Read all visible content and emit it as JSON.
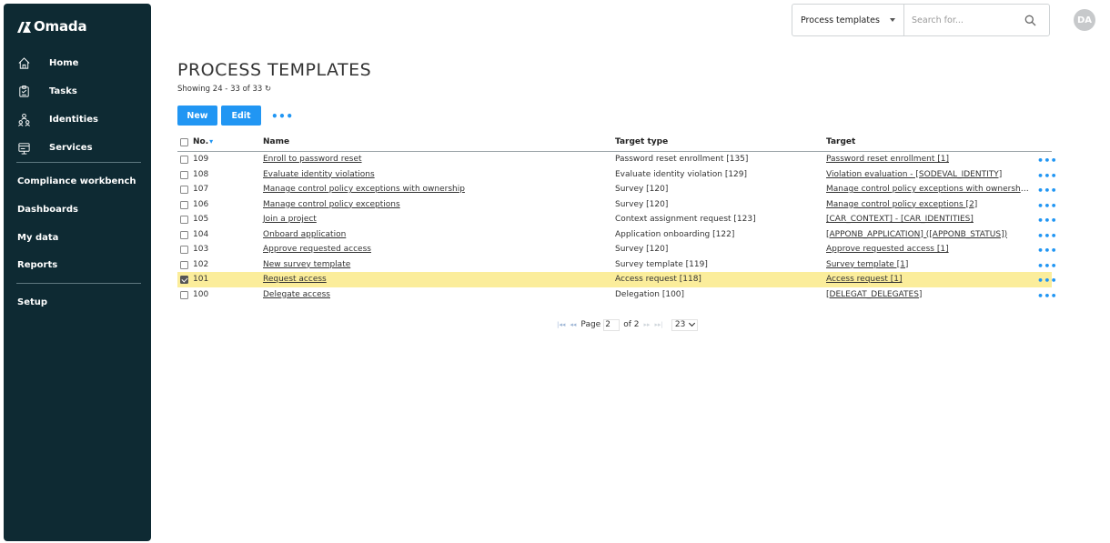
{
  "app": {
    "brand": "Omada"
  },
  "sidebar": {
    "main_items": [
      {
        "label": "Home",
        "icon": "home-icon"
      },
      {
        "label": "Tasks",
        "icon": "tasks-icon"
      },
      {
        "label": "Identities",
        "icon": "identities-icon"
      },
      {
        "label": "Services",
        "icon": "services-icon"
      }
    ],
    "secondary_items": [
      {
        "label": "Compliance workbench"
      },
      {
        "label": "Dashboards"
      },
      {
        "label": "My data"
      },
      {
        "label": "Reports"
      }
    ],
    "tertiary_items": [
      {
        "label": "Setup"
      }
    ]
  },
  "topbar": {
    "search_scope": "Process templates",
    "search_placeholder": "Search for...",
    "avatar_initials": "DA"
  },
  "page": {
    "title": "PROCESS TEMPLATES",
    "showing": "Showing 24 - 33 of 33",
    "refresh_glyph": "↻",
    "new_label": "New",
    "edit_label": "Edit",
    "more_glyph": "•••"
  },
  "table": {
    "headers": {
      "no": "No.",
      "name": "Name",
      "target_type": "Target type",
      "target": "Target"
    },
    "rows": [
      {
        "no": "109",
        "name": "Enroll to password reset",
        "target_type": "Password reset enrollment [135]",
        "target": "Password reset enrollment [1]",
        "checked": false
      },
      {
        "no": "108",
        "name": "Evaluate identity violations",
        "target_type": "Evaluate identity violation [129]",
        "target": "Violation evaluation - [SODEVAL_IDENTITY]",
        "checked": false
      },
      {
        "no": "107",
        "name": "Manage control policy exceptions with ownership",
        "target_type": "Survey [120]",
        "target": "Manage control policy exceptions with ownershi...",
        "checked": false
      },
      {
        "no": "106",
        "name": "Manage control policy exceptions",
        "target_type": "Survey [120]",
        "target": "Manage control policy exceptions [2]",
        "checked": false
      },
      {
        "no": "105",
        "name": "Join a project",
        "target_type": "Context assignment request [123]",
        "target": "[CAR_CONTEXT] - [CAR_IDENTITIES]",
        "checked": false
      },
      {
        "no": "104",
        "name": "Onboard application",
        "target_type": "Application onboarding [122]",
        "target": "[APPONB_APPLICATION] ([APPONB_STATUS])",
        "checked": false
      },
      {
        "no": "103",
        "name": "Approve requested access",
        "target_type": "Survey [120]",
        "target": "Approve requested access [1]",
        "checked": false
      },
      {
        "no": "102",
        "name": "New survey template",
        "target_type": "Survey template [119]",
        "target": "Survey template [1]",
        "checked": false
      },
      {
        "no": "101",
        "name": "Request access",
        "target_type": "Access request [118]",
        "target": "Access request [1]",
        "checked": true
      },
      {
        "no": "100",
        "name": "Delegate access",
        "target_type": "Delegation [100]",
        "target": "[DELEGAT_DELEGATES]",
        "checked": false
      }
    ]
  },
  "pager": {
    "page_label": "Page",
    "current_page": "2",
    "of_label": "of 2",
    "page_size": "23"
  }
}
